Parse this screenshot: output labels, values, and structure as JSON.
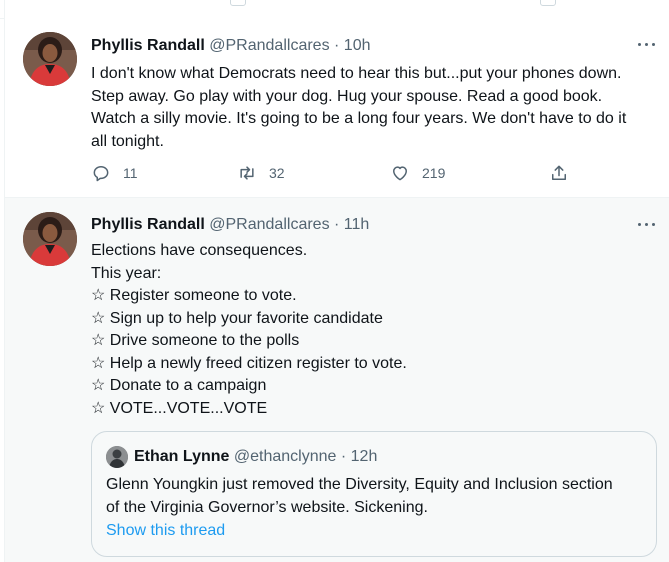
{
  "colors": {
    "accent": "#1d9bf0",
    "text_primary": "#0f1419",
    "text_secondary": "#536471",
    "border": "#eff3f4"
  },
  "tweets": [
    {
      "name": "Phyllis Randall",
      "handle": "@PRandallcares",
      "dot": "·",
      "time": "10h",
      "lines": [
        "I don't know what Democrats need to hear this but...put your phones down.",
        "Step away. Go play with your dog. Hug your spouse. Read a good book.",
        "Watch a silly movie. It's going to be a long four years. We don't have to do it",
        "all tonight."
      ],
      "actions": {
        "reply_count": "11",
        "retweet_count": "32",
        "like_count": "219",
        "reply_icon": "reply-icon",
        "retweet_icon": "retweet-icon",
        "like_icon": "heart-icon",
        "share_icon": "share-icon"
      }
    },
    {
      "name": "Phyllis Randall",
      "handle": "@PRandallcares",
      "dot": "·",
      "time": "11h",
      "lines": [
        "Elections have consequences.",
        "This year:",
        "☆ Register someone to vote.",
        "☆ Sign up to help your favorite candidate",
        "☆ Drive someone to the polls",
        "☆ Help a newly freed citizen register to vote.",
        "☆ Donate to a campaign",
        "☆ VOTE...VOTE...VOTE"
      ],
      "quote": {
        "name": "Ethan Lynne",
        "handle": "@ethanclynne",
        "dot": "·",
        "time": "12h",
        "lines": [
          "Glenn Youngkin just removed the Diversity, Equity and Inclusion section",
          "of the Virginia Governor’s website. Sickening."
        ],
        "show_thread": "Show this thread"
      }
    }
  ]
}
